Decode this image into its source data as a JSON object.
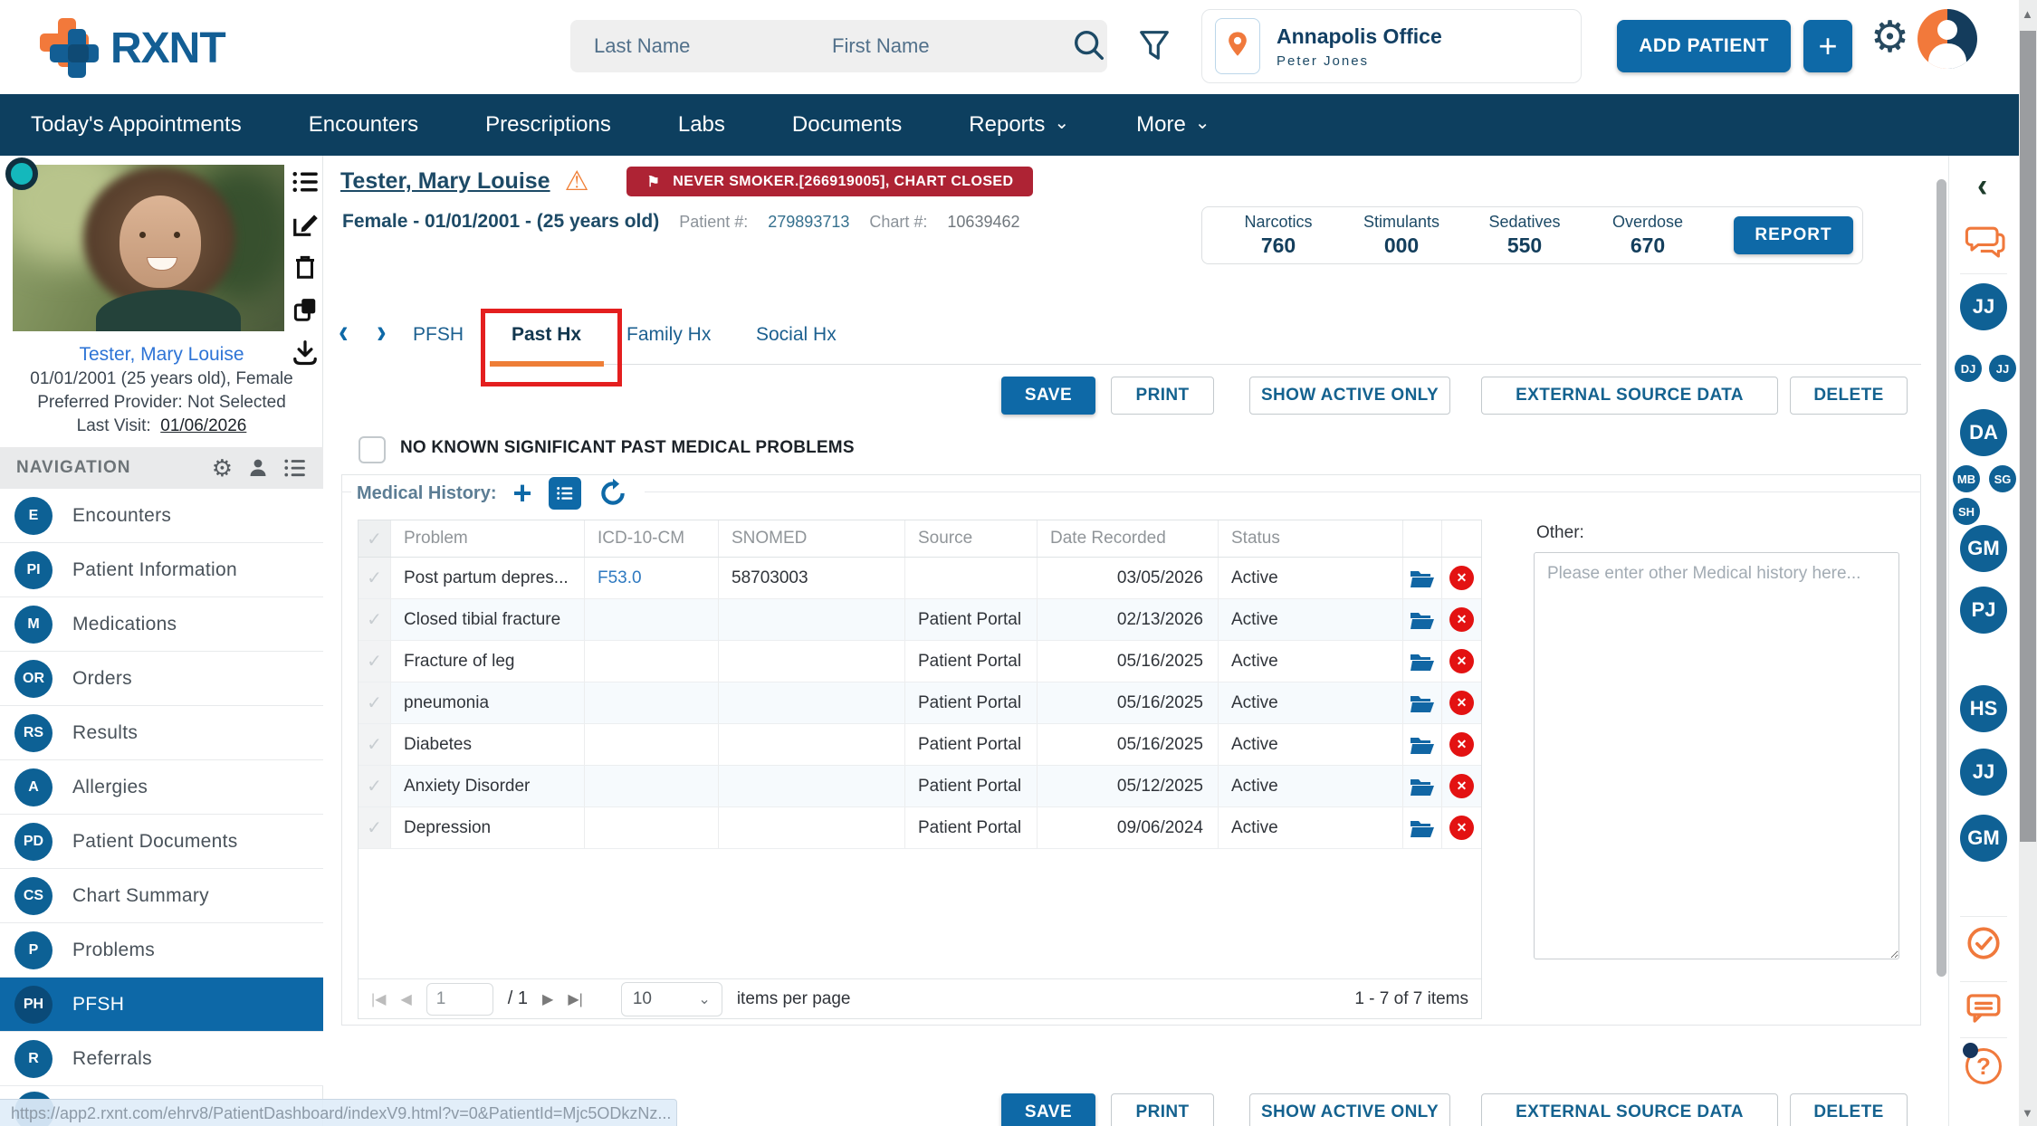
{
  "header": {
    "brand": "RXNT",
    "last_name_placeholder": "Last Name",
    "first_name_placeholder": "First Name",
    "office_name": "Annapolis Office",
    "office_user": "Peter Jones",
    "add_patient": "ADD PATIENT",
    "plus": "+"
  },
  "navbar": {
    "items": [
      {
        "label": "Today's Appointments"
      },
      {
        "label": "Encounters"
      },
      {
        "label": "Prescriptions"
      },
      {
        "label": "Labs"
      },
      {
        "label": "Documents"
      },
      {
        "label": "Reports",
        "dropdown": true
      },
      {
        "label": "More",
        "dropdown": true
      }
    ]
  },
  "banner": {
    "patient_name": "Tester, Mary Louise",
    "flag_badge": "NEVER SMOKER.[266919005], CHART CLOSED",
    "demographics": "Female - 01/01/2001 - (25 years old)",
    "patient_number_label": "Patient #:",
    "patient_number": "279893713",
    "chart_number_label": "Chart #:",
    "chart_number": "10639462",
    "scores": [
      {
        "label": "Narcotics",
        "value": "760"
      },
      {
        "label": "Stimulants",
        "value": "000"
      },
      {
        "label": "Sedatives",
        "value": "550"
      },
      {
        "label": "Overdose",
        "value": "670"
      }
    ],
    "report_button": "REPORT"
  },
  "tabs": {
    "items": [
      {
        "label": "PFSH"
      },
      {
        "label": "Past Hx",
        "active": true
      },
      {
        "label": "Family Hx"
      },
      {
        "label": "Social Hx"
      }
    ]
  },
  "toolbar": {
    "save": "SAVE",
    "print": "PRINT",
    "show_active_only": "SHOW ACTIVE ONLY",
    "external_source_data": "EXTERNAL SOURCE DATA",
    "delete": "DELETE"
  },
  "past_hx": {
    "no_known_label": "NO KNOWN SIGNIFICANT PAST MEDICAL PROBLEMS",
    "section_label": "Medical History:",
    "table": {
      "columns": [
        "Problem",
        "ICD-10-CM",
        "SNOMED",
        "Source",
        "Date Recorded",
        "Status"
      ],
      "rows": [
        {
          "problem": "Post partum depres...",
          "icd10": "F53.0",
          "snomed": "58703003",
          "source": "",
          "date_recorded": "03/05/2026",
          "status": "Active"
        },
        {
          "problem": "Closed tibial fracture",
          "icd10": "",
          "snomed": "",
          "source": "Patient Portal",
          "date_recorded": "02/13/2026",
          "status": "Active"
        },
        {
          "problem": "Fracture of leg",
          "icd10": "",
          "snomed": "",
          "source": "Patient Portal",
          "date_recorded": "05/16/2025",
          "status": "Active"
        },
        {
          "problem": "pneumonia",
          "icd10": "",
          "snomed": "",
          "source": "Patient Portal",
          "date_recorded": "05/16/2025",
          "status": "Active"
        },
        {
          "problem": "Diabetes",
          "icd10": "",
          "snomed": "",
          "source": "Patient Portal",
          "date_recorded": "05/16/2025",
          "status": "Active"
        },
        {
          "problem": "Anxiety Disorder",
          "icd10": "",
          "snomed": "",
          "source": "Patient Portal",
          "date_recorded": "05/12/2025",
          "status": "Active"
        },
        {
          "problem": "Depression",
          "icd10": "",
          "snomed": "",
          "source": "Patient Portal",
          "date_recorded": "09/06/2024",
          "status": "Active"
        }
      ]
    },
    "pager": {
      "page": "1",
      "of_label": "/ 1",
      "page_size": "10",
      "items_per_page_label": "items per page",
      "range_label": "1 - 7 of 7 items"
    },
    "other_label": "Other:",
    "other_placeholder": "Please enter other Medical history here..."
  },
  "sidebar": {
    "patient_name": "Tester, Mary Louise",
    "patient_demographics": "01/01/2001 (25 years old), Female",
    "preferred_provider": "Preferred Provider: Not Selected",
    "last_visit_label": "Last Visit:",
    "last_visit_date": "01/06/2026",
    "navigation_title": "NAVIGATION",
    "items": [
      {
        "badge": "E",
        "label": "Encounters"
      },
      {
        "badge": "PI",
        "label": "Patient Information"
      },
      {
        "badge": "M",
        "label": "Medications"
      },
      {
        "badge": "OR",
        "label": "Orders"
      },
      {
        "badge": "RS",
        "label": "Results"
      },
      {
        "badge": "A",
        "label": "Allergies"
      },
      {
        "badge": "PD",
        "label": "Patient Documents"
      },
      {
        "badge": "CS",
        "label": "Chart Summary"
      },
      {
        "badge": "P",
        "label": "Problems"
      },
      {
        "badge": "PH",
        "label": "PFSH",
        "active": true
      },
      {
        "badge": "R",
        "label": "Referrals"
      }
    ]
  },
  "right_rail": {
    "avatars": [
      {
        "initials": "JJ",
        "size": "large"
      },
      {
        "initials": "DJ",
        "size": "small"
      },
      {
        "initials": "JJ",
        "size": "small"
      },
      {
        "initials": "DA",
        "size": "large"
      },
      {
        "initials": "MB",
        "size": "small"
      },
      {
        "initials": "SG",
        "size": "small"
      },
      {
        "initials": "SH",
        "size": "small"
      },
      {
        "initials": "GM",
        "size": "large"
      },
      {
        "initials": "PJ",
        "size": "large"
      },
      {
        "initials": "HS",
        "size": "large"
      },
      {
        "initials": "JJ",
        "size": "large"
      },
      {
        "initials": "GM",
        "size": "large"
      }
    ]
  },
  "statusbar": {
    "url": "https://app2.rxnt.com/ehrv8/PatientDashboard/indexV9.html?v=0&PatientId=Mjc5ODkzNz..."
  },
  "glyphs": {
    "check": "✓",
    "warning": "⚠",
    "flag": "⚑",
    "caret_down": "⌄",
    "chevron_left": "‹",
    "chevron_right": "›",
    "x_mark": "✕",
    "plus": "+",
    "gear": "⚙",
    "pager_first": "|◀",
    "pager_prev": "◀",
    "pager_next": "▶",
    "pager_last": "▶|",
    "scroll_up": "▲",
    "scroll_down": "▼",
    "question": "?"
  },
  "colors": {
    "navy": "#0d3f5f",
    "primary_blue": "#0e69a7",
    "accent_orange": "#f0793c",
    "flag_red": "#ae2334",
    "annotation_red": "#e41f1f",
    "delete_red": "#e31212"
  }
}
